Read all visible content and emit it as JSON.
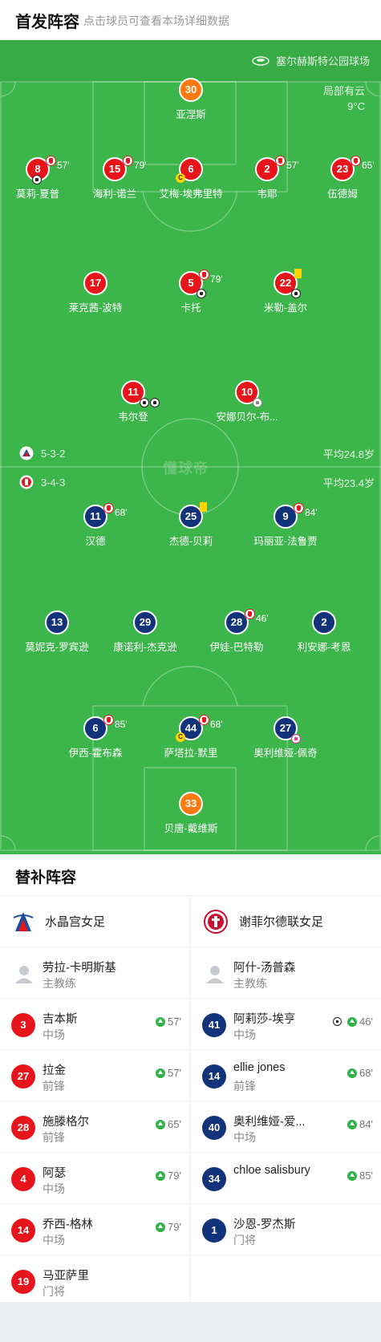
{
  "header": {
    "title": "首发阵容",
    "subtitle": "点击球员可查看本场详细数据"
  },
  "match": {
    "stadium": "塞尔赫斯特公园球场",
    "weather_desc": "局部有云",
    "temperature": "9°C",
    "watermark": "懂球帝"
  },
  "home": {
    "name": "水晶宫女足",
    "formation": "5-3-2",
    "avg_age": "平均24.8岁",
    "color": "#e8141c",
    "coach": {
      "name": "劳拉-卡明斯基",
      "role": "主教练"
    },
    "lineup": [
      {
        "number": "30",
        "name": "亚涅斯",
        "color": "orange",
        "events": []
      },
      {
        "number": "8",
        "name": "莫莉-夏普",
        "color": "red",
        "sub_min": "57'",
        "events": [
          "goal"
        ]
      },
      {
        "number": "15",
        "name": "海利-诺兰",
        "color": "red",
        "sub_min": "79'",
        "events": []
      },
      {
        "number": "6",
        "name": "艾梅-埃弗里特",
        "color": "red",
        "events": [
          "captain"
        ]
      },
      {
        "number": "2",
        "name": "韦耶",
        "color": "red",
        "sub_min": "57'",
        "events": []
      },
      {
        "number": "23",
        "name": "伍德姆",
        "color": "red",
        "sub_min": "65'",
        "events": []
      },
      {
        "number": "17",
        "name": "莱克茜-波特",
        "color": "red",
        "events": []
      },
      {
        "number": "5",
        "name": "卡托",
        "color": "red",
        "sub_min": "79'",
        "events": [
          "goal"
        ]
      },
      {
        "number": "22",
        "name": "米勒-盖尔",
        "color": "red",
        "events": [
          "yellow",
          "goal"
        ]
      },
      {
        "number": "11",
        "name": "韦尔登",
        "color": "red",
        "events": [
          "goal",
          "goal"
        ]
      },
      {
        "number": "10",
        "name": "安娜贝尔-布...",
        "color": "red",
        "events": [
          "assist"
        ]
      }
    ],
    "subs": [
      {
        "number": "3",
        "name": "吉本斯",
        "position": "中场",
        "minute": "57'"
      },
      {
        "number": "27",
        "name": "拉金",
        "position": "前锋",
        "minute": "57'"
      },
      {
        "number": "28",
        "name": "施滕格尔",
        "position": "前锋",
        "minute": "65'"
      },
      {
        "number": "4",
        "name": "阿瑟",
        "position": "中场",
        "minute": "79'"
      },
      {
        "number": "14",
        "name": "乔西-格林",
        "position": "中场",
        "minute": "79'"
      },
      {
        "number": "19",
        "name": "马亚萨里",
        "position": "门将",
        "minute": ""
      }
    ]
  },
  "away": {
    "name": "谢菲尔德联女足",
    "formation": "3-4-3",
    "avg_age": "平均23.4岁",
    "color": "#12337a",
    "coach": {
      "name": "阿什-汤普森",
      "role": "主教练"
    },
    "lineup": [
      {
        "number": "11",
        "name": "汉德",
        "color": "blue",
        "sub_min": "68'",
        "events": []
      },
      {
        "number": "25",
        "name": "杰德-贝莉",
        "color": "blue",
        "events": [
          "yellow"
        ]
      },
      {
        "number": "9",
        "name": "玛丽亚-法鲁贾",
        "color": "blue",
        "sub_min": "84'",
        "events": []
      },
      {
        "number": "13",
        "name": "莫妮克-罗宾逊",
        "color": "blue",
        "events": []
      },
      {
        "number": "29",
        "name": "康诺利-杰克逊",
        "color": "blue",
        "events": []
      },
      {
        "number": "28",
        "name": "伊娃-巴特勒",
        "color": "blue",
        "sub_min": "46'",
        "events": []
      },
      {
        "number": "2",
        "name": "利安娜-考恩",
        "color": "blue",
        "events": []
      },
      {
        "number": "6",
        "name": "伊西-霍布森",
        "color": "blue",
        "sub_min": "85'",
        "events": []
      },
      {
        "number": "44",
        "name": "萨塔拉-默里",
        "color": "blue",
        "sub_min": "68'",
        "events": [
          "captain"
        ]
      },
      {
        "number": "27",
        "name": "奥利维娅-佩奇",
        "color": "blue",
        "events": [
          "own-goal"
        ]
      },
      {
        "number": "33",
        "name": "贝唐-戴维斯",
        "color": "orange",
        "events": []
      }
    ],
    "subs": [
      {
        "number": "41",
        "name": "阿莉莎-埃亨",
        "position": "中场",
        "minute": "46'",
        "goal": true
      },
      {
        "number": "14",
        "name": "ellie jones",
        "position": "前锋",
        "minute": "68'"
      },
      {
        "number": "40",
        "name": "奥利维娅-爱...",
        "position": "中场",
        "minute": "84'"
      },
      {
        "number": "34",
        "name": "chloe salisbury",
        "position": "",
        "minute": "85'"
      },
      {
        "number": "1",
        "name": "沙恩-罗杰斯",
        "position": "门将",
        "minute": ""
      }
    ]
  },
  "subs_section": {
    "title": "替补阵容"
  },
  "icons": [
    "stadium-icon",
    "home-badge-icon",
    "away-badge-icon",
    "coach-avatar-icon",
    "sub-in-arrow-icon",
    "sub-out-icon",
    "goal-ball-icon",
    "yellow-card-icon",
    "captain-icon"
  ]
}
